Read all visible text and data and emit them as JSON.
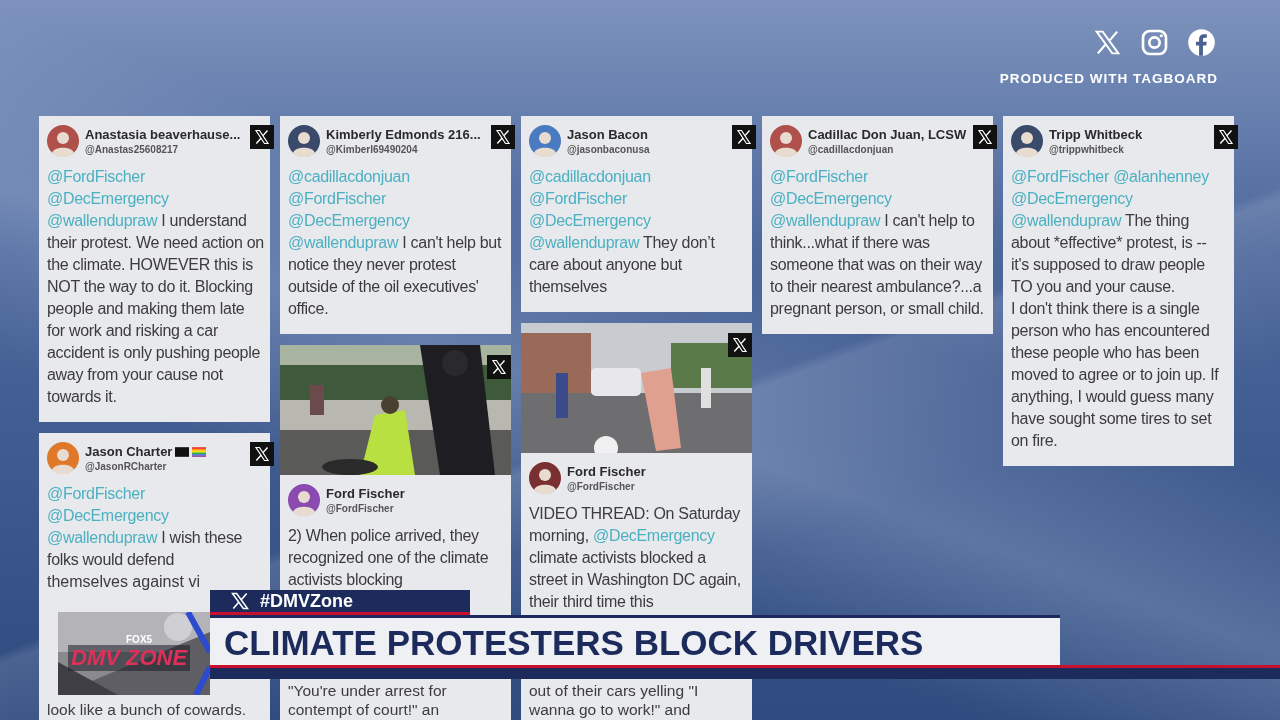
{
  "header": {
    "credit": "PRODUCED WITH TAGBOARD"
  },
  "columns": [
    {
      "cards": [
        {
          "kind": "text",
          "name": "Anastasia beaverhause...",
          "handle": "@Anastas25608217",
          "flags": false,
          "segments": [
            {
              "kind": "mention",
              "text": "@FordFischer"
            },
            {
              "kind": "mention",
              "text": "@DecEmergency"
            },
            {
              "kind": "mention",
              "text": "@wallendupraw"
            },
            {
              "kind": "text",
              "text": " I understand their protest. We need action on the climate. HOWEVER this is NOT the way to do it. Blocking people and making them late for work and risking a car accident is only pushing people away from your cause not towards it."
            }
          ]
        },
        {
          "kind": "text",
          "name": "Jason Charter",
          "handle": "@JasonRCharter",
          "flags": true,
          "segments": [
            {
              "kind": "mention",
              "text": "@FordFischer"
            },
            {
              "kind": "mention",
              "text": "@DecEmergency"
            },
            {
              "kind": "mention",
              "text": "@wallendupraw"
            },
            {
              "kind": "text",
              "text": " I wish these folks would defend"
            }
          ],
          "partial_line": "themselves against vi",
          "segments_after": [
            {
              "kind": "text",
              "text": "look like a bunch of cowards."
            }
          ]
        }
      ]
    },
    {
      "cards": [
        {
          "kind": "text",
          "name": "Kimberly Edmonds 216...",
          "handle": "@Kimberl69490204",
          "flags": false,
          "segments": [
            {
              "kind": "mention",
              "text": "@cadillacdonjuan"
            },
            {
              "kind": "mention",
              "text": "@FordFischer"
            },
            {
              "kind": "mention",
              "text": "@DecEmergency"
            },
            {
              "kind": "mention",
              "text": "@wallendupraw"
            },
            {
              "kind": "text",
              "text": " I can't help but notice they never protest outside of the oil executives' office."
            }
          ]
        },
        {
          "kind": "media",
          "name": "Ford Fischer",
          "handle": "@FordFischer",
          "flags": false,
          "segments": [
            {
              "kind": "text",
              "text": "2) When police arrived, they recognized one of the climate activists blocking"
            }
          ],
          "segments_after": [
            {
              "kind": "text",
              "text": "\"You're under arrest for\ncontempt of court!\" an"
            }
          ]
        }
      ]
    },
    {
      "cards": [
        {
          "kind": "text",
          "name": "Jason Bacon",
          "handle": "@jasonbaconusa",
          "flags": false,
          "segments": [
            {
              "kind": "mention",
              "text": "@cadillacdonjuan"
            },
            {
              "kind": "mention",
              "text": "@FordFischer"
            },
            {
              "kind": "mention",
              "text": "@DecEmergency"
            },
            {
              "kind": "mention",
              "text": "@wallendupraw"
            },
            {
              "kind": "text",
              "text": " They don’t care about anyone but themselves"
            }
          ]
        },
        {
          "kind": "media",
          "name": "Ford Fischer",
          "handle": "@FordFischer",
          "flags": false,
          "segments": [
            {
              "kind": "text",
              "text": "VIDEO THREAD: On Saturday morning, "
            },
            {
              "kind": "mention",
              "text": "@DecEmergency"
            },
            {
              "kind": "text",
              "text": " climate activists blocked a street in Washington DC again, their third time this"
            }
          ],
          "segments_after": [
            {
              "kind": "text",
              "text": "out of their cars yelling \"I\nwanna go to work!\" and"
            }
          ]
        }
      ]
    },
    {
      "cards": [
        {
          "kind": "text",
          "name": "Cadillac Don Juan, LCSW",
          "handle": "@cadillacdonjuan",
          "flags": false,
          "segments": [
            {
              "kind": "mention",
              "text": "@FordFischer"
            },
            {
              "kind": "mention",
              "text": "@DecEmergency"
            },
            {
              "kind": "mention",
              "text": "@wallendupraw"
            },
            {
              "kind": "text",
              "text": " I can't help to think...what if there was someone that was on their way to their nearest ambulance?...a pregnant person, or small child."
            }
          ]
        }
      ]
    },
    {
      "cards": [
        {
          "kind": "text",
          "name": "Tripp Whitbeck",
          "handle": "@trippwhitbeck",
          "flags": false,
          "segments": [
            {
              "kind": "mention",
              "text": "@FordFischer"
            },
            {
              "kind": "mention",
              "text": "@alanhenney"
            },
            {
              "kind": "mention",
              "text": "@DecEmergency"
            },
            {
              "kind": "mention",
              "text": "@wallendupraw"
            },
            {
              "kind": "text",
              "text": " The thing about *effective* protest, is -- it's supposed to draw people TO you and your cause.\nI don't think there is a single person who has encountered these people who has been moved to agree or to join up. If anything, I would guess many have sought some tires to set on fire."
            }
          ]
        }
      ]
    }
  ],
  "banner": {
    "hashtag": "#DMVZone",
    "headline": "CLIMATE PROTESTERS BLOCK DRIVERS",
    "logo": {
      "network": "FOX5",
      "show": "DMV ZONE"
    }
  }
}
